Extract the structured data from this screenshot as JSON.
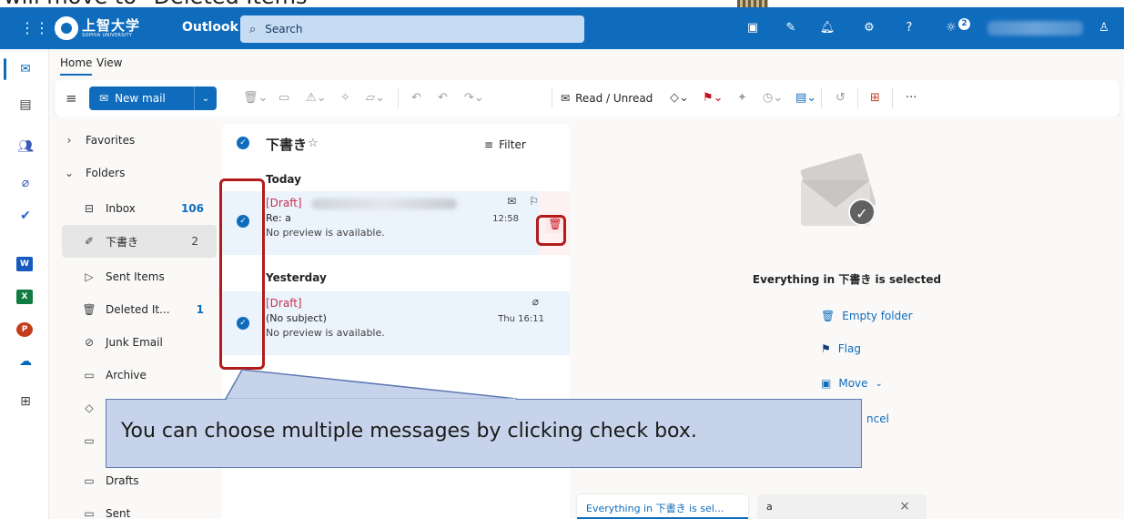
{
  "caption": {
    "text": "will move to \"Deleted Items\""
  },
  "topbar": {
    "logo_text": "上智大学",
    "logo_sub": "SOPHIA UNIVERSITY",
    "app_name": "Outlook",
    "search_placeholder": "Search",
    "badge_count": "2",
    "icons": [
      "waffle-icon",
      "teams-icon",
      "compose-icon",
      "bell-icon",
      "gear-icon",
      "help-icon",
      "lightbulb-icon",
      "account-icon"
    ]
  },
  "rail": {
    "items": [
      "mail-icon",
      "calendar-icon",
      "people-icon",
      "attach-icon",
      "todo-icon",
      "word-icon",
      "excel-icon",
      "powerpoint-icon",
      "onedrive-icon",
      "apps-icon"
    ],
    "word": "W",
    "excel": "X",
    "powerpoint": "P"
  },
  "ribbon": {
    "tabs": [
      "Home",
      "View"
    ],
    "new_mail": "New mail",
    "read_unread": "Read / Unread",
    "more": "···"
  },
  "folders": {
    "favorites": "Favorites",
    "folders": "Folders",
    "items": [
      {
        "label": "Inbox",
        "count": "106"
      },
      {
        "label": "下書き",
        "count": "2"
      },
      {
        "label": "Sent Items",
        "count": ""
      },
      {
        "label": "Deleted It...",
        "count": "1"
      },
      {
        "label": "Junk Email",
        "count": ""
      },
      {
        "label": "Archive",
        "count": ""
      },
      {
        "label": "Drafts",
        "count": ""
      },
      {
        "label": "Sent",
        "count": ""
      }
    ]
  },
  "message_list": {
    "title": "下書き",
    "filter": "Filter",
    "group_today": "Today",
    "group_yesterday": "Yesterday",
    "messages": [
      {
        "tag": "[Draft]",
        "subject": "Re: a",
        "preview": "No preview is available.",
        "time": "12:58"
      },
      {
        "tag": "[Draft]",
        "subject": "(No subject)",
        "preview": "No preview is available.",
        "time": "Thu 16:11"
      }
    ]
  },
  "reading": {
    "everything_selected": "Everything in 下書き is selected",
    "empty_folder": "Empty folder",
    "flag": "Flag",
    "move": "Move",
    "cancel_fragment": "ncel",
    "tab_active": "Everything in 下書き is sel...",
    "tab_other": "a"
  },
  "annotation": {
    "callout_text": "You can choose multiple messages by clicking check box.",
    "highlight_color": "#b31b1b",
    "callout_color": "#c7d3ea"
  },
  "colors": {
    "brand": "#0f6cbd",
    "draft_red": "#c4314b"
  }
}
